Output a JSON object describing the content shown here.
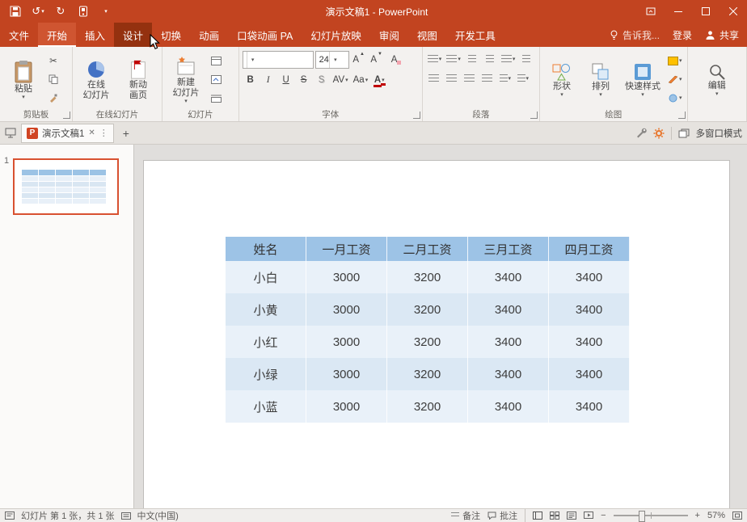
{
  "colors": {
    "accent_red": "#C24420",
    "tab_hover_dark": "#94310F",
    "table_header_blue": "#9DC3E6",
    "table_row_light": "#E9F1F9",
    "table_row_dark": "#DBE8F4",
    "selection_orange": "#D85131"
  },
  "icons": {
    "undo": "↺",
    "redo": "↻",
    "caret": "▾",
    "tri_up": "▲",
    "tri_dn": "▼",
    "scissors": "✂",
    "close_tab": "✕",
    "more_dots": "⋮",
    "plus": "+",
    "minus": "−",
    "ppt_logo": "P"
  },
  "titlebar": {
    "title": "演示文稿1 - PowerPoint"
  },
  "ribbon_tabs": [
    "文件",
    "开始",
    "插入",
    "设计",
    "切换",
    "动画",
    "口袋动画 PA",
    "幻灯片放映",
    "审阅",
    "视图",
    "开发工具"
  ],
  "ribbon_right": {
    "tell_me": "告诉我...",
    "sign_in": "登录",
    "share": "共享"
  },
  "ribbon": {
    "clipboard": {
      "paste": "粘贴",
      "group": "剪贴板"
    },
    "online": {
      "b1_l1": "在线",
      "b1_l2": "幻灯片",
      "b2_l1": "新动",
      "b2_l2": "画页",
      "group": "在线幻灯片"
    },
    "slides": {
      "l1": "新建",
      "l2": "幻灯片",
      "group": "幻灯片"
    },
    "font": {
      "group": "字体",
      "name": "",
      "size": "24",
      "bold": "B",
      "italic": "I",
      "underline": "U",
      "strikethrough": "S",
      "shadow": "S",
      "spacing": "AV",
      "case_label": "Aa",
      "color_label": "A",
      "grow": "A",
      "shrink": "A",
      "clear": "A"
    },
    "paragraph": {
      "group": "段落"
    },
    "drawing": {
      "shapes": "形状",
      "arrange": "排列",
      "quick_styles": "快速样式",
      "group": "绘图"
    },
    "editing": {
      "label": "编辑"
    }
  },
  "doc_tabbar": {
    "tab_title": "演示文稿1",
    "multi_window": "多窗口模式"
  },
  "slides_panel": {
    "slide_number": "1"
  },
  "slide_table": {
    "headers": [
      "姓名",
      "一月工资",
      "二月工资",
      "三月工资",
      "四月工资"
    ],
    "rows": [
      [
        "小白",
        "3000",
        "3200",
        "3400",
        "3400"
      ],
      [
        "小黄",
        "3000",
        "3200",
        "3400",
        "3400"
      ],
      [
        "小红",
        "3000",
        "3200",
        "3400",
        "3400"
      ],
      [
        "小绿",
        "3000",
        "3200",
        "3400",
        "3400"
      ],
      [
        "小蓝",
        "3000",
        "3200",
        "3400",
        "3400"
      ]
    ]
  },
  "statusbar": {
    "slide_info": "幻灯片 第 1 张，共 1 张",
    "language": "中文(中国)",
    "notes": "备注",
    "comments": "批注",
    "zoom_level": "57%"
  }
}
